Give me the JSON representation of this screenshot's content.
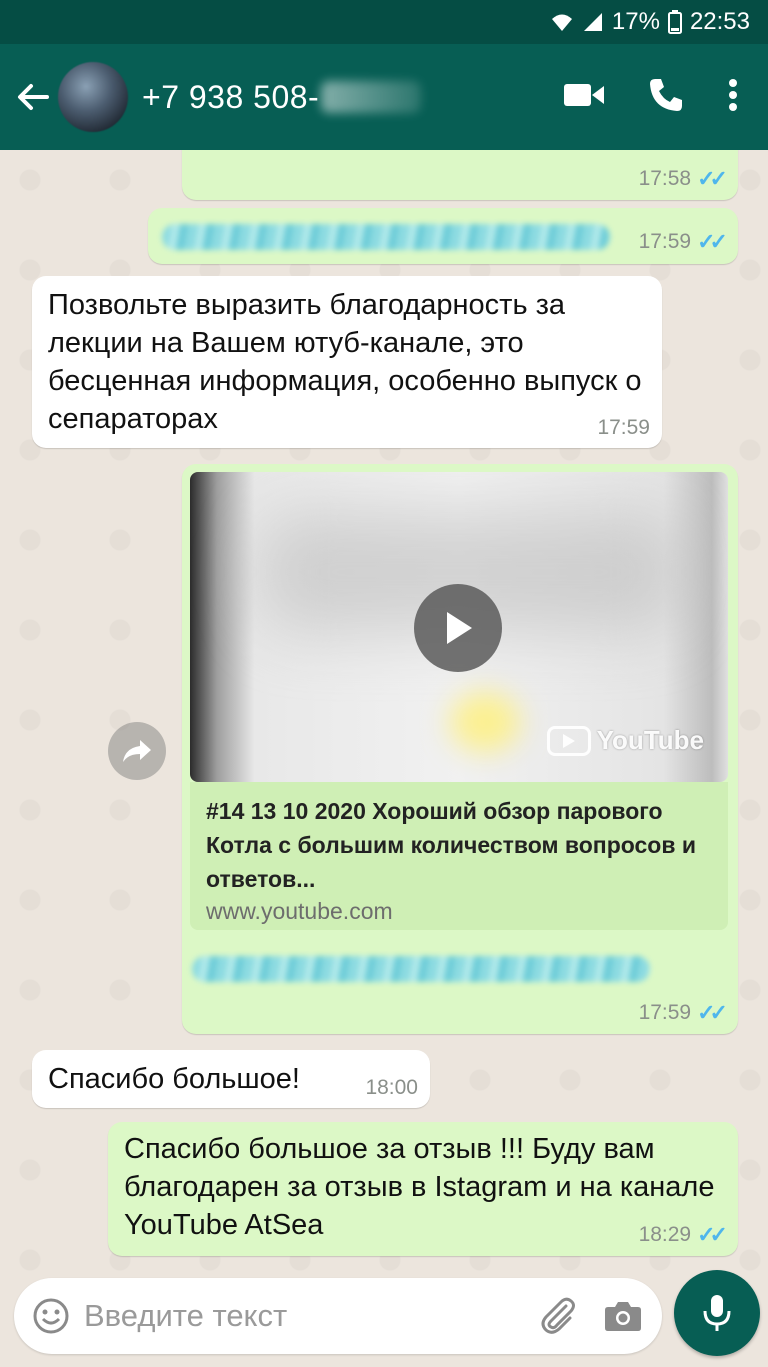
{
  "status_bar": {
    "battery": "17%",
    "time": "22:53",
    "icons": [
      "wifi-icon",
      "signal-icon",
      "battery-icon"
    ]
  },
  "header": {
    "contact_number": "+7 938 508-",
    "icons": [
      "back-arrow-icon",
      "video-call-icon",
      "phone-icon",
      "more-vert-icon"
    ]
  },
  "messages": [
    {
      "direction": "out",
      "time": "17:58",
      "status": "read"
    },
    {
      "direction": "out",
      "time": "17:59",
      "status": "read"
    },
    {
      "direction": "in",
      "text": "Позвольте выразить благодарность за лекции на Вашем ютуб-канале, это бесценная информация, особенно выпуск о сепараторах",
      "time": "17:59"
    },
    {
      "direction": "out",
      "time": "17:59",
      "status": "read",
      "link_preview": {
        "title": "#14 13 10 2020 Хороший обзор парового Котла с большим количеством вопросов и ответов...",
        "url": "www.youtube.com",
        "video_badge": "YouTube"
      }
    },
    {
      "direction": "in",
      "text": "Спасибо большое!",
      "time": "18:00"
    },
    {
      "direction": "out",
      "text": "Спасибо большое за отзыв !!! Буду вам благодарен за отзыв в Istagram  и на канале YouTube AtSea",
      "time": "18:29",
      "status": "read"
    }
  ],
  "composer": {
    "placeholder": "Введите текст",
    "icons": [
      "emoji-icon",
      "attach-icon",
      "camera-icon",
      "mic-icon"
    ]
  },
  "colors": {
    "header": "#075e54",
    "status_bar": "#054d44",
    "outgoing_bubble": "#dcf8c6",
    "incoming_bubble": "#ffffff",
    "read_ticks": "#4fb6ec",
    "chat_background": "#ece5dd"
  }
}
